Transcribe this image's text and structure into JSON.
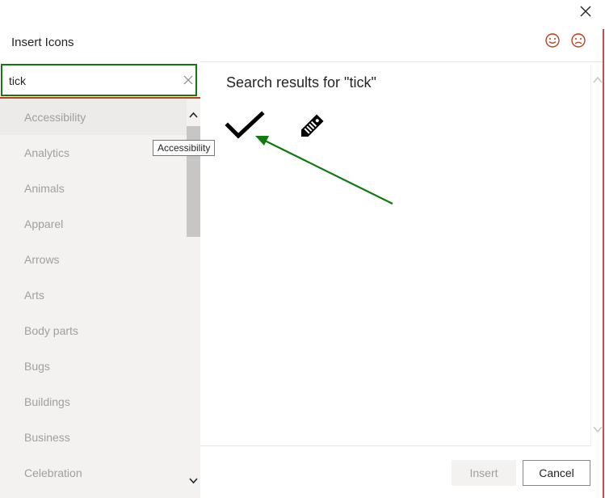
{
  "dialog": {
    "title": "Insert Icons",
    "close_icon": "close-icon",
    "feedback": {
      "smile_icon": "smile-icon",
      "frown_icon": "frown-icon"
    }
  },
  "search": {
    "value": "tick",
    "placeholder": "",
    "clear_icon": "close-icon",
    "border_color": "#0f7b0f"
  },
  "categories": {
    "items": [
      "Accessibility",
      "Analytics",
      "Animals",
      "Apparel",
      "Arrows",
      "Arts",
      "Body parts",
      "Bugs",
      "Buildings",
      "Business",
      "Celebration"
    ],
    "hovered": "Accessibility",
    "tooltip": "Accessibility"
  },
  "results": {
    "heading": "Search results for \"tick\"",
    "icons": [
      "checkmark-icon",
      "price-tag-icon"
    ]
  },
  "annotation": {
    "color": "#0f7b0f",
    "type": "arrow"
  },
  "footer": {
    "insert_label": "Insert",
    "cancel_label": "Cancel"
  },
  "colors": {
    "accent": "#c43e1c",
    "text": "#252423",
    "muted": "#a19f9d"
  }
}
